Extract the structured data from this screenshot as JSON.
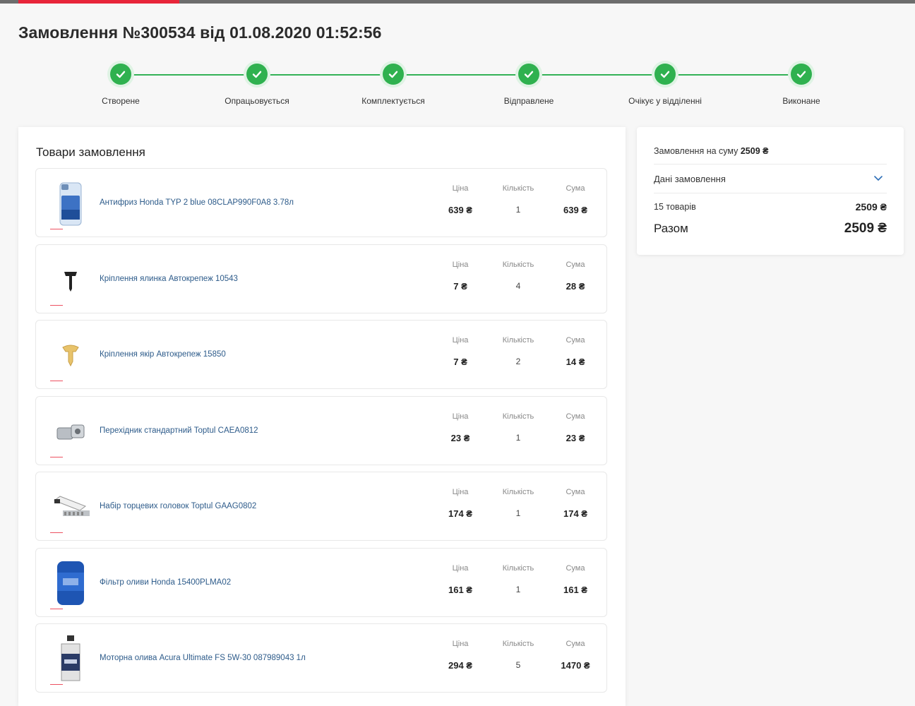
{
  "colors": {
    "accent": "#e8253a",
    "success": "#2fb14f",
    "link": "#2d5b8a"
  },
  "page_title": "Замовлення №300534 від 01.08.2020 01:52:56",
  "progress": [
    {
      "label": "Створене",
      "icon": "check-icon"
    },
    {
      "label": "Опрацьовується",
      "icon": "check-icon"
    },
    {
      "label": "Комплектується",
      "icon": "check-icon"
    },
    {
      "label": "Відправлене",
      "icon": "check-icon"
    },
    {
      "label": "Очікує у відділенні",
      "icon": "check-icon"
    },
    {
      "label": "Виконане",
      "icon": "check-icon"
    }
  ],
  "items_section": {
    "title": "Товари замовлення",
    "col_price": "Ціна",
    "col_qty": "Кількість",
    "col_sum": "Сума",
    "items": [
      {
        "name": "Антифриз Honda TYP 2 blue 08CLAP990F0A8 3.78л",
        "price": "639 ₴",
        "qty": "1",
        "sum": "639 ₴",
        "icon": "antifreeze-bottle-icon"
      },
      {
        "name": "Кріплення ялинка Автокрепеж 10543",
        "price": "7 ₴",
        "qty": "4",
        "sum": "28 ₴",
        "icon": "clip-icon"
      },
      {
        "name": "Кріплення якір Автокрепеж 15850",
        "price": "7 ₴",
        "qty": "2",
        "sum": "14 ₴",
        "icon": "anchor-clip-icon"
      },
      {
        "name": "Перехідник стандартний Toptul CAEA0812",
        "price": "23 ₴",
        "qty": "1",
        "sum": "23 ₴",
        "icon": "socket-adapter-icon"
      },
      {
        "name": "Набір торцевих головок Toptul GAAG0802",
        "price": "174 ₴",
        "qty": "1",
        "sum": "174 ₴",
        "icon": "socket-set-icon"
      },
      {
        "name": "Фільтр оливи Honda 15400PLMA02",
        "price": "161 ₴",
        "qty": "1",
        "sum": "161 ₴",
        "icon": "oil-filter-icon"
      },
      {
        "name": "Моторна олива Acura Ultimate FS 5W-30 087989043 1л",
        "price": "294 ₴",
        "qty": "5",
        "sum": "1470 ₴",
        "icon": "oil-bottle-icon"
      }
    ]
  },
  "summary": {
    "order_sum_label": "Замовлення на суму",
    "order_sum_value": "2509 ₴",
    "details_label": "Дані замовлення",
    "details_icon": "chevron-down-icon",
    "count_label": "15 товарів",
    "count_value": "2509 ₴",
    "total_label": "Разом",
    "total_value": "2509 ₴"
  }
}
